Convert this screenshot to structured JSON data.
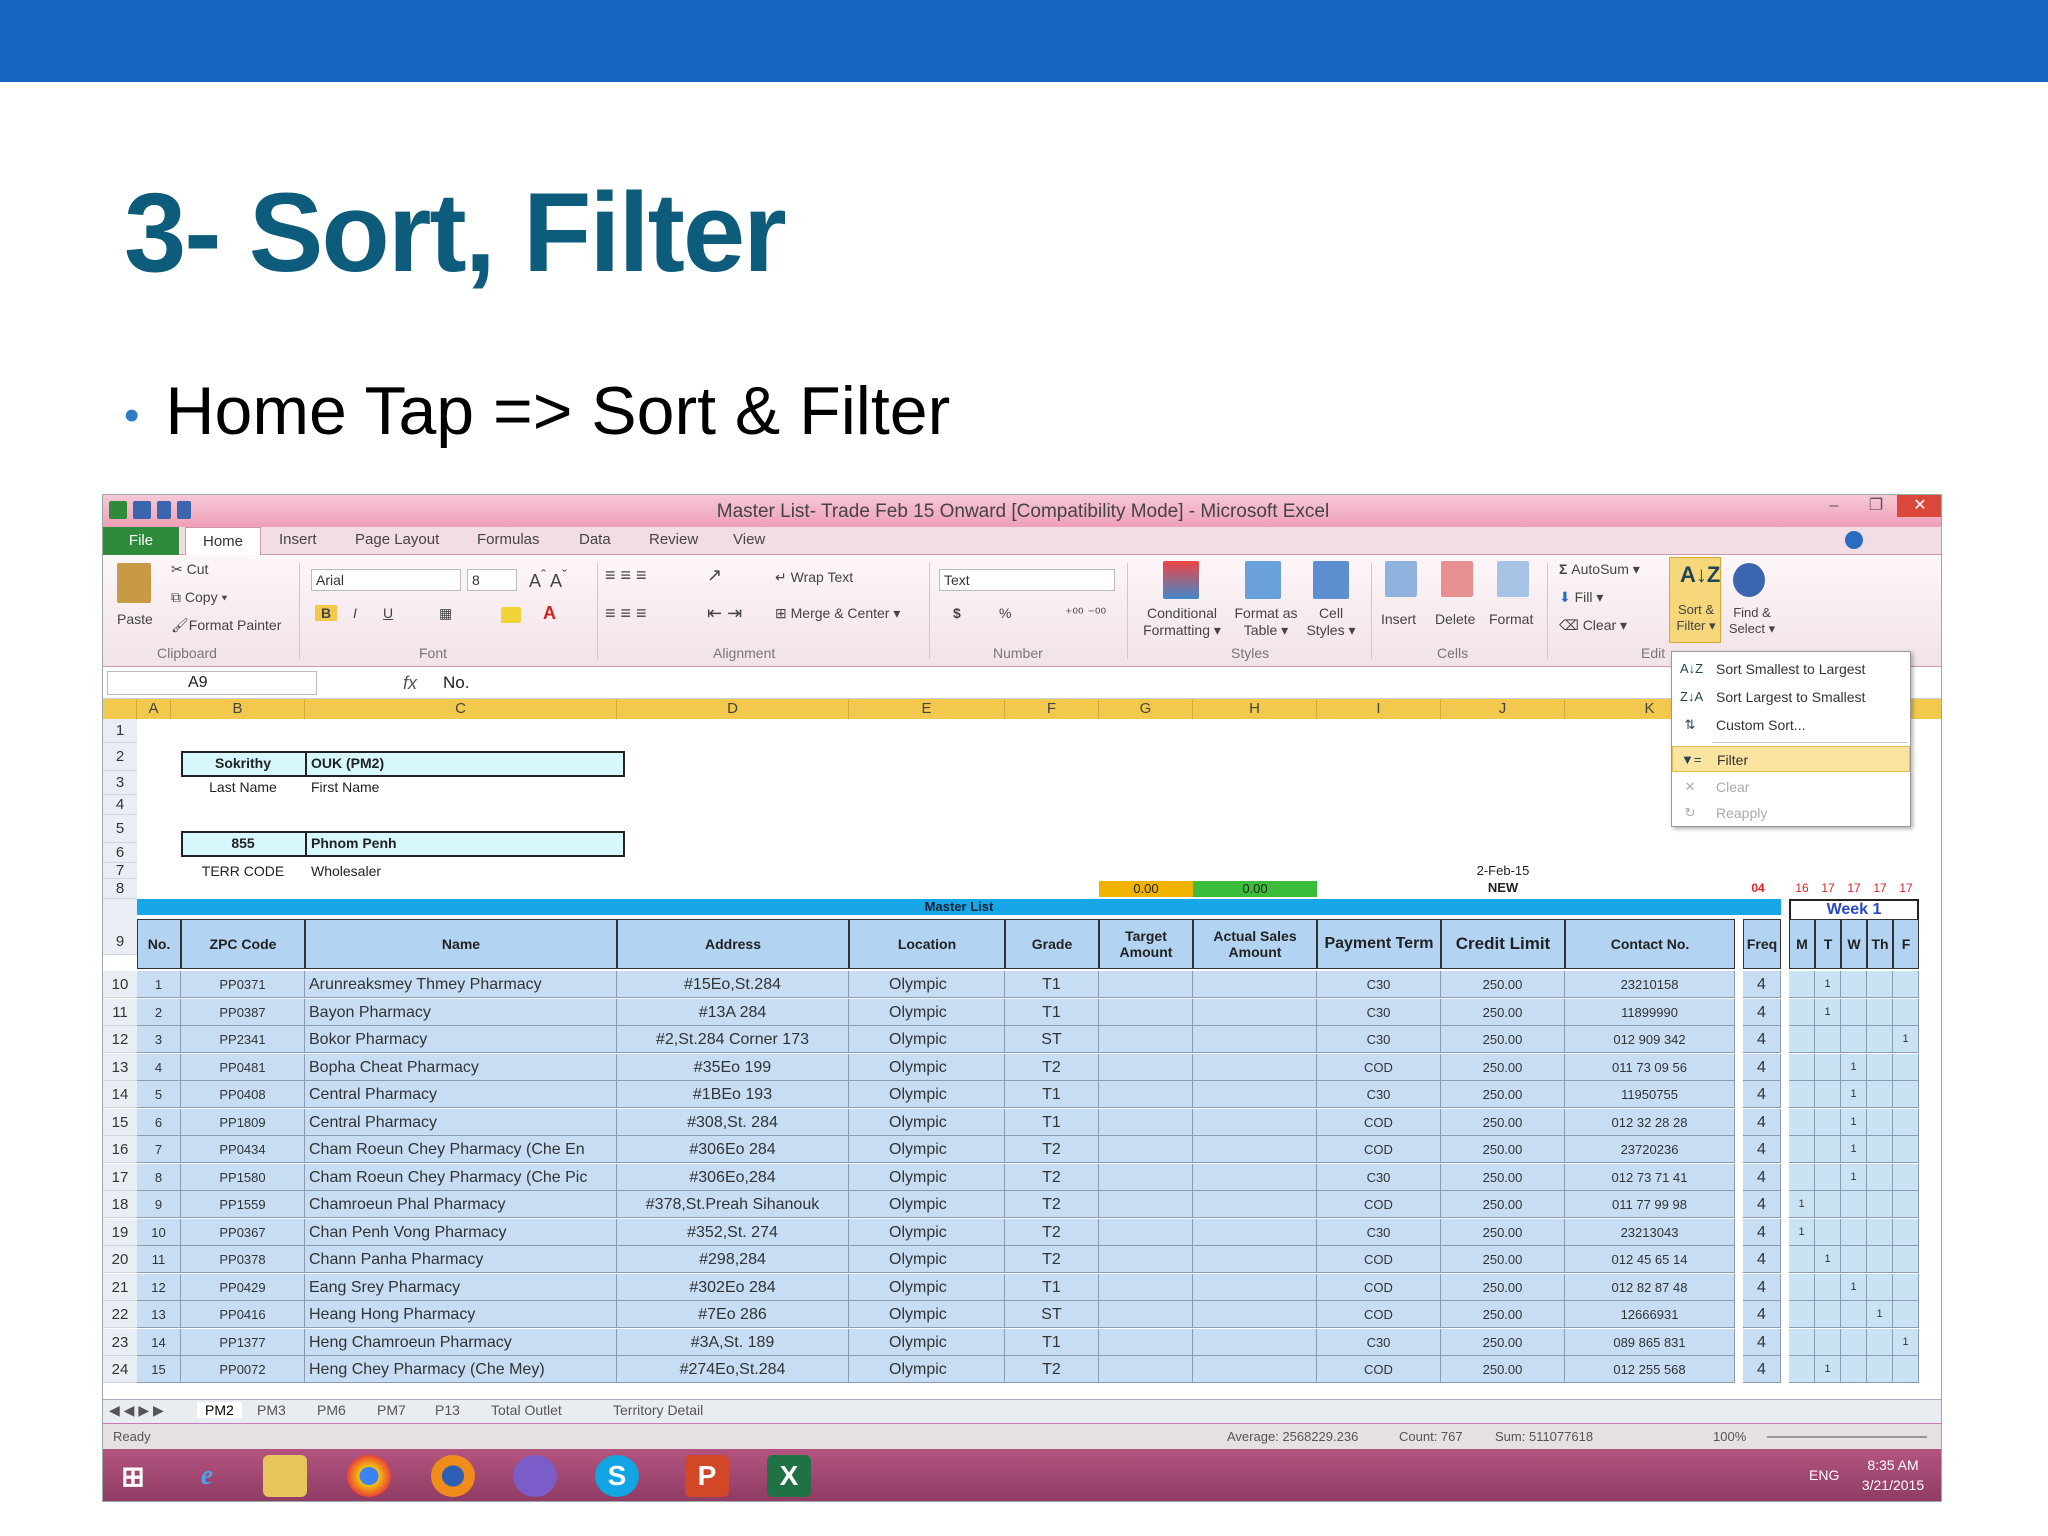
{
  "slide": {
    "title": "3- Sort, Filter",
    "bullet": "Home Tap => Sort & Filter"
  },
  "excel": {
    "window_title": "Master List- Trade  Feb 15 Onward  [Compatibility Mode]  -  Microsoft Excel",
    "tabs": [
      "File",
      "Home",
      "Insert",
      "Page Layout",
      "Formulas",
      "Data",
      "Review",
      "View"
    ],
    "ribbon": {
      "paste": "Paste",
      "cut": "Cut",
      "copy": "Copy ▾",
      "format_painter": "Format Painter",
      "clipboard": "Clipboard",
      "font_name": "Arial",
      "font_size": "8",
      "bold": "B",
      "italic": "I",
      "underline": "U",
      "font_group": "Font",
      "wrap_text": "Wrap Text",
      "merge_center": "Merge & Center ▾",
      "alignment": "Alignment",
      "number_format": "Text",
      "dollar": "$",
      "percent": "%",
      "number": "Number",
      "conditional": "Conditional Formatting ▾",
      "format_table": "Format as Table ▾",
      "cell_styles": "Cell Styles ▾",
      "styles": "Styles",
      "insert": "Insert",
      "delete": "Delete",
      "format": "Format",
      "cells": "Cells",
      "autosum": "AutoSum ▾",
      "fill": "Fill ▾",
      "clear": "Clear ▾",
      "editing": "Edit",
      "sort_filter": "Sort & Filter ▾",
      "find_select": "Find & Select ▾"
    },
    "name_box": "A9",
    "fx": "fx",
    "formula": "No.",
    "columns": [
      "A",
      "B",
      "C",
      "D",
      "E",
      "F",
      "G",
      "H",
      "I",
      "J",
      "K"
    ],
    "top_cells": {
      "b2": "Sokrithy",
      "c2": "OUK (PM2)",
      "b3": "Last Name",
      "c3": "First Name",
      "b5": "855",
      "c5": "Phnom Penh",
      "b6": "TERR CODE",
      "c6": "Wholesaler",
      "g7": "0.00",
      "h7": "0.00",
      "j6": "2-Feb-15",
      "j7": "NEW",
      "k7": "04",
      "master": "Master List",
      "week": "Week 1",
      "days_top": [
        "16",
        "17",
        "17",
        "17",
        "17"
      ]
    },
    "headers": [
      "No.",
      "ZPC Code",
      "Name",
      "Address",
      "Location",
      "Grade",
      "Target Amount",
      "Actual Sales Amount",
      "Payment Term",
      "Credit Limit",
      "Contact No.",
      "Freq",
      "M",
      "T",
      "W",
      "Th",
      "F"
    ],
    "rows": [
      {
        "r": "10",
        "no": "1",
        "code": "PP0371",
        "name": "Arunreaksmey Thmey Pharmacy",
        "addr": "#15Eo,St.284",
        "loc": "Olympic",
        "grade": "T1",
        "term": "C30",
        "credit": "250.00",
        "contact": "23210158",
        "freq": "4",
        "m": "",
        "t": "1",
        "w": "",
        "th": "",
        "f": ""
      },
      {
        "r": "11",
        "no": "2",
        "code": "PP0387",
        "name": "Bayon Pharmacy",
        "addr": "#13A 284",
        "loc": "Olympic",
        "grade": "T1",
        "term": "C30",
        "credit": "250.00",
        "contact": "11899990",
        "freq": "4",
        "m": "",
        "t": "1",
        "w": "",
        "th": "",
        "f": ""
      },
      {
        "r": "12",
        "no": "3",
        "code": "PP2341",
        "name": "Bokor Pharmacy",
        "addr": "#2,St.284 Corner 173",
        "loc": "Olympic",
        "grade": "ST",
        "term": "C30",
        "credit": "250.00",
        "contact": "012 909 342",
        "freq": "4",
        "m": "",
        "t": "",
        "w": "",
        "th": "",
        "f": "1"
      },
      {
        "r": "13",
        "no": "4",
        "code": "PP0481",
        "name": "Bopha Cheat Pharmacy",
        "addr": "#35Eo 199",
        "loc": "Olympic",
        "grade": "T2",
        "term": "COD",
        "credit": "250.00",
        "contact": "011 73 09 56",
        "freq": "4",
        "m": "",
        "t": "",
        "w": "1",
        "th": "",
        "f": ""
      },
      {
        "r": "14",
        "no": "5",
        "code": "PP0408",
        "name": "Central Pharmacy",
        "addr": "#1BEo 193",
        "loc": "Olympic",
        "grade": "T1",
        "term": "C30",
        "credit": "250.00",
        "contact": "11950755",
        "freq": "4",
        "m": "",
        "t": "",
        "w": "1",
        "th": "",
        "f": ""
      },
      {
        "r": "15",
        "no": "6",
        "code": "PP1809",
        "name": "Central Pharmacy",
        "addr": "#308,St. 284",
        "loc": "Olympic",
        "grade": "T1",
        "term": "COD",
        "credit": "250.00",
        "contact": "012 32 28 28",
        "freq": "4",
        "m": "",
        "t": "",
        "w": "1",
        "th": "",
        "f": ""
      },
      {
        "r": "16",
        "no": "7",
        "code": "PP0434",
        "name": "Cham Roeun Chey Pharmacy (Che En",
        "addr": "#306Eo 284",
        "loc": "Olympic",
        "grade": "T2",
        "term": "COD",
        "credit": "250.00",
        "contact": "23720236",
        "freq": "4",
        "m": "",
        "t": "",
        "w": "1",
        "th": "",
        "f": ""
      },
      {
        "r": "17",
        "no": "8",
        "code": "PP1580",
        "name": "Cham Roeun Chey Pharmacy (Che Pic",
        "addr": "#306Eo,284",
        "loc": "Olympic",
        "grade": "T2",
        "term": "C30",
        "credit": "250.00",
        "contact": "012 73 71 41",
        "freq": "4",
        "m": "",
        "t": "",
        "w": "1",
        "th": "",
        "f": ""
      },
      {
        "r": "18",
        "no": "9",
        "code": "PP1559",
        "name": "Chamroeun Phal Pharmacy",
        "addr": "#378,St.Preah Sihanouk",
        "loc": "Olympic",
        "grade": "T2",
        "term": "COD",
        "credit": "250.00",
        "contact": "011 77 99 98",
        "freq": "4",
        "m": "1",
        "t": "",
        "w": "",
        "th": "",
        "f": ""
      },
      {
        "r": "19",
        "no": "10",
        "code": "PP0367",
        "name": "Chan Penh Vong Pharmacy",
        "addr": "#352,St. 274",
        "loc": "Olympic",
        "grade": "T2",
        "term": "C30",
        "credit": "250.00",
        "contact": "23213043",
        "freq": "4",
        "m": "1",
        "t": "",
        "w": "",
        "th": "",
        "f": ""
      },
      {
        "r": "20",
        "no": "11",
        "code": "PP0378",
        "name": "Chann Panha Pharmacy",
        "addr": "#298,284",
        "loc": "Olympic",
        "grade": "T2",
        "term": "COD",
        "credit": "250.00",
        "contact": "012 45 65 14",
        "freq": "4",
        "m": "",
        "t": "1",
        "w": "",
        "th": "",
        "f": ""
      },
      {
        "r": "21",
        "no": "12",
        "code": "PP0429",
        "name": "Eang Srey Pharmacy",
        "addr": "#302Eo 284",
        "loc": "Olympic",
        "grade": "T1",
        "term": "COD",
        "credit": "250.00",
        "contact": "012 82 87 48",
        "freq": "4",
        "m": "",
        "t": "",
        "w": "1",
        "th": "",
        "f": ""
      },
      {
        "r": "22",
        "no": "13",
        "code": "PP0416",
        "name": "Heang Hong Pharmacy",
        "addr": "#7Eo 286",
        "loc": "Olympic",
        "grade": "ST",
        "term": "COD",
        "credit": "250.00",
        "contact": "12666931",
        "freq": "4",
        "m": "",
        "t": "",
        "w": "",
        "th": "1",
        "f": ""
      },
      {
        "r": "23",
        "no": "14",
        "code": "PP1377",
        "name": "Heng Chamroeun Pharmacy",
        "addr": "#3A,St. 189",
        "loc": "Olympic",
        "grade": "T1",
        "term": "C30",
        "credit": "250.00",
        "contact": "089 865 831",
        "freq": "4",
        "m": "",
        "t": "",
        "w": "",
        "th": "",
        "f": "1"
      },
      {
        "r": "24",
        "no": "15",
        "code": "PP0072",
        "name": "Heng Chey Pharmacy (Che Mey)",
        "addr": "#274Eo,St.284",
        "loc": "Olympic",
        "grade": "T2",
        "term": "COD",
        "credit": "250.00",
        "contact": "012 255 568",
        "freq": "4",
        "m": "",
        "t": "1",
        "w": "",
        "th": "",
        "f": ""
      }
    ],
    "sort_menu": [
      {
        "label": "Sort Smallest to Largest",
        "icon": "A↓Z"
      },
      {
        "label": "Sort Largest to Smallest",
        "icon": "Z↓A"
      },
      {
        "label": "Custom Sort...",
        "icon": "⇅"
      },
      {
        "label": "Filter",
        "icon": "▼="
      },
      {
        "label": "Clear",
        "icon": "✕"
      },
      {
        "label": "Reapply",
        "icon": "↻"
      }
    ],
    "sheet_tabs": [
      "PM2",
      "PM3",
      "PM6",
      "PM7",
      "P13",
      "Total Outlet",
      "Territory Detail"
    ],
    "status": {
      "ready": "Ready",
      "average": "Average: 2568229.236",
      "count": "Count: 767",
      "sum": "Sum: 511077618",
      "zoom": "100%"
    },
    "taskbar": {
      "lang": "ENG",
      "time": "8:35 AM",
      "date": "3/21/2015"
    }
  }
}
